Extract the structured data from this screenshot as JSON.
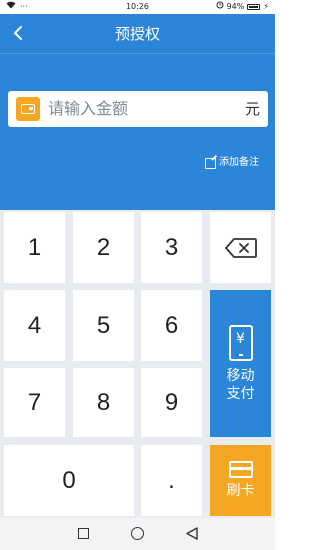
{
  "status_bar": {
    "time": "10:26",
    "battery": "94%",
    "dots": "···"
  },
  "header": {
    "title": "预授权",
    "back_icon": "chevron-left-icon"
  },
  "amount": {
    "placeholder": "请输入金额",
    "unit": "元",
    "icon": "wallet-icon"
  },
  "note": {
    "label": "添加备注",
    "icon": "edit-icon"
  },
  "keypad": {
    "keys": [
      "1",
      "2",
      "3",
      "4",
      "5",
      "6",
      "7",
      "8",
      "9",
      "0",
      "."
    ],
    "delete_icon": "backspace-icon",
    "pay_label_line1": "移动",
    "pay_label_line2": "支付",
    "swipe_label": "刷卡"
  },
  "colors": {
    "primary": "#2b86d9",
    "accent": "#f5a623",
    "keypad_bg": "#e8ebef"
  }
}
